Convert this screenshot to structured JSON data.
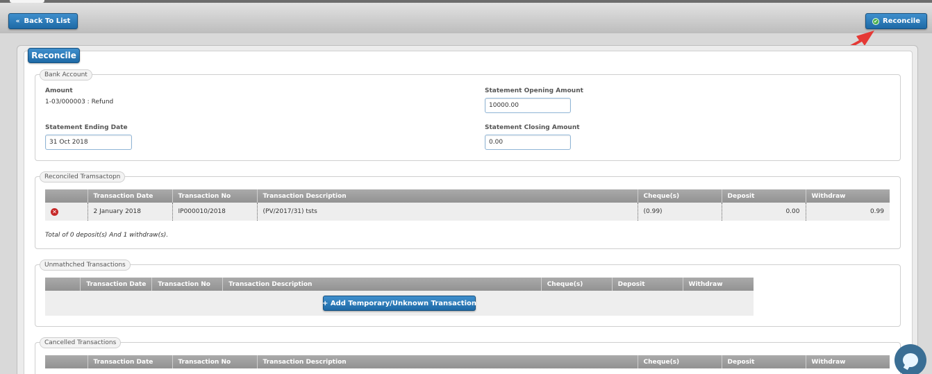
{
  "toolbar": {
    "back_label": "Back To List",
    "back_icon": "double-chevron-left-icon",
    "reconcile_label": "Reconcile",
    "reconcile_icon": "check-circle-icon"
  },
  "panel": {
    "title": "Reconcile"
  },
  "bank_account": {
    "legend": "Bank Account",
    "amount_label": "Amount",
    "amount_value": "1-03/000003 : Refund",
    "opening_label": "Statement Opening Amount",
    "opening_value": "10000.00",
    "ending_date_label": "Statement Ending Date",
    "ending_date_value": "31 Oct 2018",
    "closing_label": "Statement Closing Amount",
    "closing_value": "0.00"
  },
  "reconciled": {
    "legend": "Reconciled Tramsactopn",
    "columns": [
      "",
      "Transaction Date",
      "Transaction No",
      "Transaction Description",
      "Cheque(s)",
      "Deposit",
      "Withdraw"
    ],
    "rows": [
      {
        "icon": "remove-icon",
        "date": "2 January 2018",
        "no": "IP000010/2018",
        "desc": "(PV/2017/31) tsts",
        "cheque": "(0.99)",
        "deposit": "0.00",
        "withdraw": "0.99"
      }
    ],
    "total_note": "Total of 0 deposit(s) And 1 withdraw(s)."
  },
  "unmatched": {
    "legend": "Unmathched Transactions",
    "columns": [
      "",
      "Transaction Date",
      "Transaction No",
      "Transaction Description",
      "Cheque(s)",
      "Deposit",
      "Withdraw"
    ],
    "add_label": "+ Add Temporary/Unknown Transaction"
  },
  "cancelled": {
    "legend": "Cancelled Transactions",
    "columns": [
      "",
      "Transaction Date",
      "Transaction No",
      "Transaction Description",
      "Cheque(s)",
      "Deposit",
      "Withdraw"
    ]
  },
  "colors": {
    "primary_button": "#2b7bbc",
    "header_gray": "#9e9e9e",
    "annotation_arrow": "#e53935",
    "chat_widget": "#3a6e94"
  }
}
